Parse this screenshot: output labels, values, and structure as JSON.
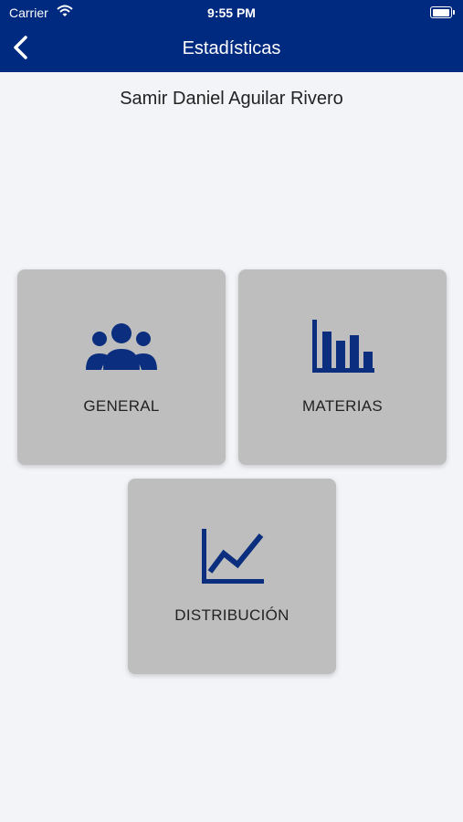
{
  "status_bar": {
    "carrier": "Carrier",
    "time": "9:55 PM"
  },
  "nav": {
    "title": "Estadísticas"
  },
  "user": {
    "name": "Samir Daniel Aguilar Rivero"
  },
  "tiles": [
    {
      "label": "GENERAL",
      "icon": "group-icon"
    },
    {
      "label": "MATERIAS",
      "icon": "bar-chart-icon"
    },
    {
      "label": "DISTRIBUCIÓN",
      "icon": "line-chart-icon"
    }
  ],
  "colors": {
    "header": "#002a7f",
    "icon": "#0b2f7e",
    "tile": "#bebebe",
    "background": "#f2f4f8"
  }
}
